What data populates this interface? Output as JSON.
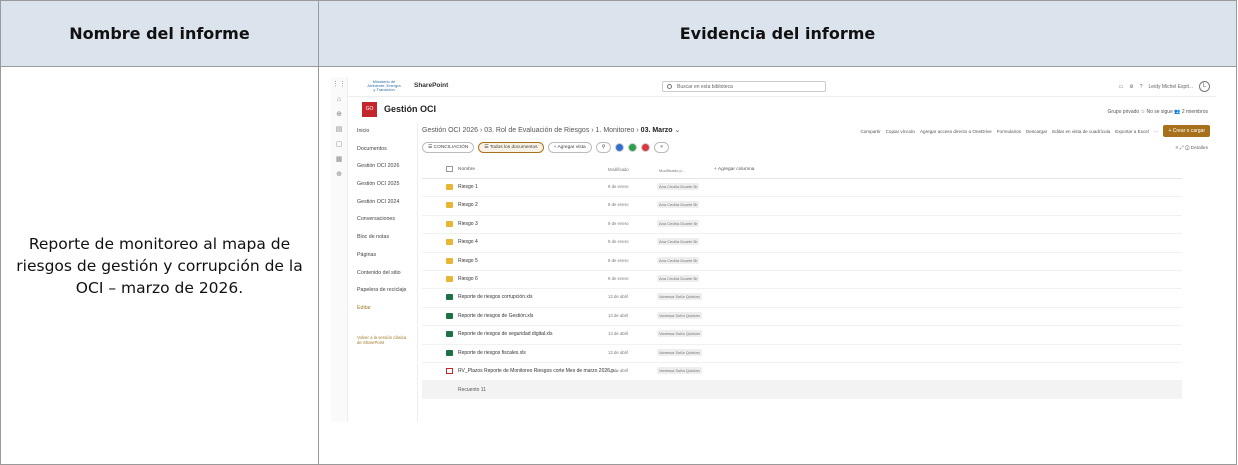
{
  "header": {
    "col1": "Nombre del informe",
    "col2": "Evidencia del informe"
  },
  "report_name": "Reporte de monitoreo al mapa de riesgos de gestión y corrupción de la OCI – marzo de 2026.",
  "screenshot": {
    "app": "SharePoint",
    "logo_text": "Ministerio de Ambiente, Energía y Transición",
    "search_placeholder": "Buscar en esta biblioteca",
    "user": "Leidy Michel Espit...",
    "site_initials": "GO",
    "site_name": "Gestión OCI",
    "site_meta": "Grupo privado   ☆ No se sigue   👥 2 miembros",
    "nav": [
      "Inicio",
      "Documentos",
      "Gestión OCI 2026",
      "Gestión OCI 2025",
      "Gestión OCI 2024",
      "Conversaciones",
      "Bloc de notas",
      "Páginas",
      "Contenido del sitio",
      "Papelera de reciclaje",
      "Editar"
    ],
    "nav_back": "Volver a la versión clásica de SharePoint",
    "breadcrumb": {
      "path": "Gestión OCI 2026 › 03. Rol de Evaluación de Riesgos › 1. Monitoreo › ",
      "current": "03. Marzo"
    },
    "commands": [
      "Compartir",
      "Copiar vínculo",
      "Agregar acceso directo a OneDrive",
      "Formularios",
      "Descargar",
      "Editar en vista de cuadrícula",
      "Exportar a Excel"
    ],
    "new_button": "+ Crear o cargar",
    "views": {
      "v1": "☰ CONCILIACIÓN",
      "v2": "☰ Todos los documentos",
      "v3": "+ Agregar vista"
    },
    "details": "Detalles",
    "columns": {
      "name": "Nombre",
      "modified": "Modificado",
      "modified_by": "Modificado p...",
      "add": "+ Agregar columna"
    },
    "rows": [
      {
        "type": "folder",
        "name": "Riesgo 1",
        "modified": "9 de enero",
        "by": "Ana Cecilia Duarte Br"
      },
      {
        "type": "folder",
        "name": "Riesgo 2",
        "modified": "9 de enero",
        "by": "Ana Cecilia Duarte Br"
      },
      {
        "type": "folder",
        "name": "Riesgo 3",
        "modified": "9 de enero",
        "by": "Ana Cecilia Duarte Br"
      },
      {
        "type": "folder",
        "name": "Riesgo 4",
        "modified": "9 de enero",
        "by": "Ana Cecilia Duarte Br"
      },
      {
        "type": "folder",
        "name": "Riesgo 5",
        "modified": "9 de enero",
        "by": "Ana Cecilia Duarte Br"
      },
      {
        "type": "folder",
        "name": "Riesgo 6",
        "modified": "9 de enero",
        "by": "Ana Cecilia Duarte Br"
      },
      {
        "type": "xlsx",
        "name": "Reporte de riesgos corrupción.xls",
        "modified": "13 de abril",
        "by": "Vanessa Sofía Quintan"
      },
      {
        "type": "xlsx",
        "name": "Reporte de riesgos de Gestión.xls",
        "modified": "13 de abril",
        "by": "Vanessa Sofía Quintan"
      },
      {
        "type": "xlsx",
        "name": "Reporte de riesgos de seguridad digital.xls",
        "modified": "13 de abril",
        "by": "Vanessa Sofía Quintan"
      },
      {
        "type": "xlsx",
        "name": "Reporte de riesgos fiscales.xls",
        "modified": "13 de abril",
        "by": "Vanessa Sofía Quintan"
      },
      {
        "type": "pdf",
        "name": "RV_Plazos Reporte de Monitoreo Riesgos corte Mes de marzo 2026.p...",
        "modified": "13 de abril",
        "by": "Vanessa Sofía Quintan"
      }
    ],
    "footer": "Recuento 11"
  },
  "colors": {
    "header_bg": "#dbe3ec",
    "site_tile": "#c4262e",
    "accent": "#a7711c"
  }
}
